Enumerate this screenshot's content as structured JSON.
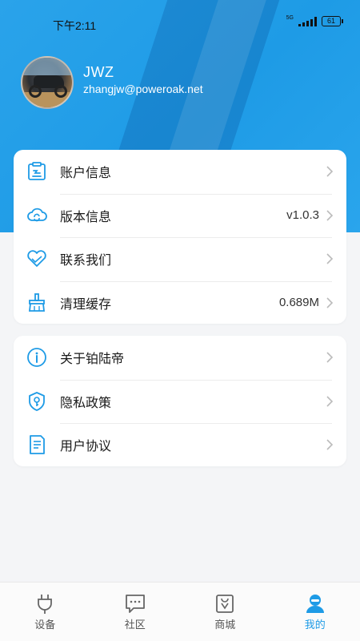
{
  "status_bar": {
    "time": "下午2:11",
    "network": "5G",
    "battery": "61"
  },
  "profile": {
    "name": "JWZ",
    "email": "zhangjw@poweroak.net"
  },
  "menu_group_1": [
    {
      "label": "账户信息",
      "value": "",
      "icon": "account-icon"
    },
    {
      "label": "版本信息",
      "value": "v1.0.3",
      "icon": "cloud-sync-icon"
    },
    {
      "label": "联系我们",
      "value": "",
      "icon": "handshake-heart-icon"
    },
    {
      "label": "清理缓存",
      "value": "0.689M",
      "icon": "broom-icon"
    }
  ],
  "menu_group_2": [
    {
      "label": "关于铂陆帝",
      "value": "",
      "icon": "info-icon"
    },
    {
      "label": "隐私政策",
      "value": "",
      "icon": "shield-key-icon"
    },
    {
      "label": "用户协议",
      "value": "",
      "icon": "document-icon"
    }
  ],
  "tabbar": [
    {
      "label": "设备",
      "icon": "plug-icon",
      "active": false
    },
    {
      "label": "社区",
      "icon": "chat-icon",
      "active": false
    },
    {
      "label": "商城",
      "icon": "shopping-bag-icon",
      "active": false
    },
    {
      "label": "我的",
      "icon": "user-icon",
      "active": true
    }
  ],
  "colors": {
    "accent": "#1e9be6",
    "header_bg": "#2aa3ea",
    "page_bg": "#f4f5f7"
  }
}
